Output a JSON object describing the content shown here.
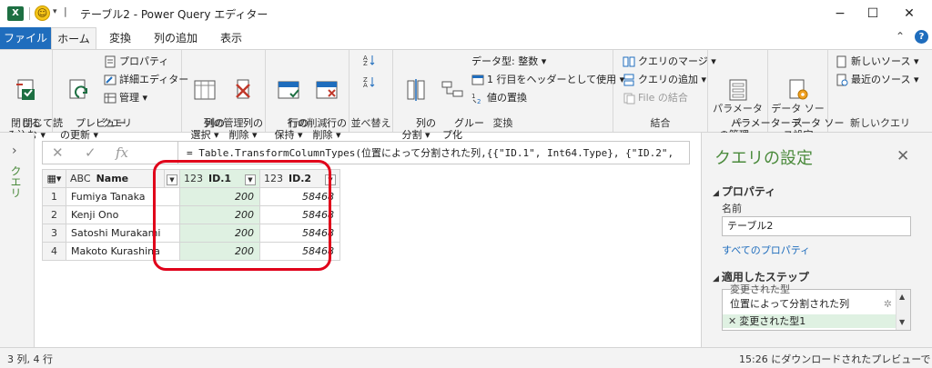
{
  "titlebar": {
    "app_icon": "X",
    "title": "テーブル2 - Power Query エディター",
    "minimize": "−",
    "maximize": "☐",
    "close": "✕"
  },
  "tabs": [
    {
      "label": "ファイル"
    },
    {
      "label": "ホーム"
    },
    {
      "label": "変換"
    },
    {
      "label": "列の追加"
    },
    {
      "label": "表示"
    }
  ],
  "ribbon": {
    "close_group": {
      "btn": "閉じて読\nみ込む ▾",
      "label": "閉じる"
    },
    "query_group": {
      "refresh": "プレビュー\nの更新 ▾",
      "properties": "プロパティ",
      "advanced_editor": "詳細エディター",
      "manage": "管理 ▾",
      "label": "クエリ"
    },
    "columns_group": {
      "choose": "列の\n選択 ▾",
      "remove": "列の\n削除 ▾",
      "label": "列の管理"
    },
    "rows_group": {
      "keep": "行の\n保持 ▾",
      "remove": "行の\n削除 ▾",
      "label": "行の削減"
    },
    "sort_group": {
      "label": "並べ替え"
    },
    "transform_group": {
      "split": "列の\n分割 ▾",
      "group": "グルー\nプ化",
      "datatype": "データ型: 整数 ▾",
      "header": "1 行目をヘッダーとして使用 ▾",
      "replace": "値の置換",
      "label": "変換"
    },
    "combine_group": {
      "merge": "クエリのマージ ▾",
      "append": "クエリの追加 ▾",
      "combine_files": "File の結合",
      "label": "結合"
    },
    "params_group": {
      "btn": "パラメーター\nの管理 ▾",
      "label": "パラメーター"
    },
    "datasource_group": {
      "btn": "データ ソー\nス設定",
      "label": "データ ソース"
    },
    "newquery_group": {
      "new_source": "新しいソース ▾",
      "recent_source": "最近のソース ▾",
      "label": "新しいクエリ"
    }
  },
  "leftnav": {
    "label": "クエリ"
  },
  "formula": {
    "text": "= Table.TransformColumnTypes(位置によって分割された列,{{\"ID.1\", Int64.Type}, {\"ID.2\","
  },
  "grid": {
    "columns": [
      {
        "type": "ABC",
        "name": "Name"
      },
      {
        "type": "123",
        "name": "ID.1"
      },
      {
        "type": "123",
        "name": "ID.2"
      }
    ],
    "rows": [
      {
        "num": "1",
        "name": "Fumiya Tanaka",
        "id1": "200",
        "id2": "58468"
      },
      {
        "num": "2",
        "name": "Kenji Ono",
        "id1": "200",
        "id2": "58468"
      },
      {
        "num": "3",
        "name": "Satoshi Murakami",
        "id1": "200",
        "id2": "58468"
      },
      {
        "num": "4",
        "name": "Makoto Kurashina",
        "id1": "200",
        "id2": "58468"
      }
    ],
    "highlight_color": "#e0001a"
  },
  "settings": {
    "title": "クエリの設定",
    "properties_head": "プロパティ",
    "name_label": "名前",
    "name_value": "テーブル2",
    "all_props_link": "すべてのプロパティ",
    "steps_head": "適用したステップ",
    "steps": [
      {
        "label": "変更された型"
      },
      {
        "label": "位置によって分割された列"
      },
      {
        "label": "変更された型1"
      }
    ]
  },
  "status": {
    "left": "3 列, 4 行",
    "right": "15:26 にダウンロードされたプレビューです"
  }
}
